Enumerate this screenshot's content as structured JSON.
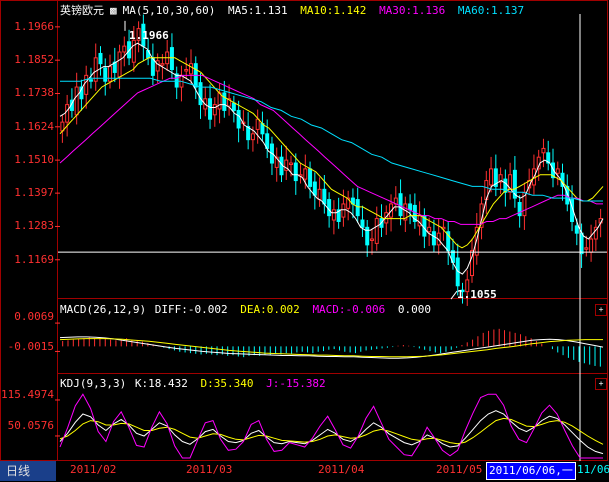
{
  "colors": {
    "up": "#ff3030",
    "down": "#00ffff",
    "ma5": "#ffffff",
    "ma10": "#ffff00",
    "ma30": "#ff00ff",
    "ma60": "#00e0ff",
    "axis": "#ff3030",
    "grid": "#a00000"
  },
  "price_panel": {
    "instrument": "英镑欧元",
    "ma_label": "MA(5,10,30,60)",
    "ma5": "MA5:1.131",
    "ma10": "MA10:1.142",
    "ma30": "MA30:1.136",
    "ma60": "MA60:1.137",
    "high_label": "1.1966",
    "low_label": "1.1055",
    "ticks": [
      "1.1966",
      "1.1852",
      "1.1738",
      "1.1624",
      "1.1510",
      "1.1397",
      "1.1283",
      "1.1169"
    ]
  },
  "macd_panel": {
    "label": "MACD(26,12,9)",
    "diff": "DIFF:-0.002",
    "dea": "DEA:0.002",
    "macd": "MACD:-0.006",
    "extra": "0.000",
    "ticks": [
      "0.0069",
      "-0.0015"
    ]
  },
  "kdj_panel": {
    "label": "KDJ(9,3,3)",
    "k": "K:18.432",
    "d": "D:35.340",
    "j": "J:-15.382",
    "ticks": [
      "115.4974",
      "50.0576"
    ]
  },
  "footer": {
    "period_tab": "日线",
    "dates": [
      "2011/02",
      "2011/03",
      "2011/04",
      "2011/05"
    ],
    "cursor_date": "2011/06/06,一",
    "tail_date": "11/06"
  },
  "chart_data": [
    {
      "type": "candlestick",
      "title": "英镑欧元",
      "y_axis_ticks": [
        1.1966,
        1.1852,
        1.1738,
        1.1624,
        1.151,
        1.1397,
        1.1283,
        1.1169
      ],
      "ylim": [
        1.1045,
        1.201
      ],
      "x_ticks": [
        "2011/02",
        "2011/03",
        "2011/04",
        "2011/05"
      ],
      "annotations": [
        {
          "label": "1.1966",
          "kind": "high"
        },
        {
          "label": "1.1055",
          "kind": "low"
        }
      ],
      "series": [
        {
          "name": "MA5",
          "last": 1.131
        },
        {
          "name": "MA10",
          "last": 1.142
        },
        {
          "name": "MA30",
          "last": 1.136
        },
        {
          "name": "MA60",
          "last": 1.137
        }
      ],
      "closes": [
        1.164,
        1.17,
        1.168,
        1.176,
        1.172,
        1.18,
        1.178,
        1.186,
        1.184,
        1.178,
        1.183,
        1.181,
        1.188,
        1.19,
        1.186,
        1.192,
        1.196,
        1.19,
        1.186,
        1.18,
        1.185,
        1.184,
        1.188,
        1.182,
        1.176,
        1.18,
        1.182,
        1.184,
        1.176,
        1.17,
        1.172,
        1.165,
        1.17,
        1.174,
        1.168,
        1.172,
        1.168,
        1.162,
        1.164,
        1.158,
        1.16,
        1.165,
        1.16,
        1.155,
        1.15,
        1.152,
        1.146,
        1.151,
        1.15,
        1.144,
        1.146,
        1.148,
        1.142,
        1.139,
        1.141,
        1.136,
        1.132,
        1.134,
        1.13,
        1.136,
        1.138,
        1.136,
        1.132,
        1.128,
        1.122,
        1.124,
        1.131,
        1.128,
        1.133,
        1.136,
        1.138,
        1.132,
        1.136,
        1.134,
        1.13,
        1.132,
        1.125,
        1.128,
        1.122,
        1.126,
        1.128,
        1.12,
        1.116,
        1.108,
        1.106,
        1.11,
        1.12,
        1.128,
        1.136,
        1.144,
        1.148,
        1.142,
        1.146,
        1.14,
        1.146,
        1.138,
        1.132,
        1.14,
        1.144,
        1.148,
        1.152,
        1.155,
        1.15,
        1.145,
        1.148,
        1.142,
        1.136,
        1.13,
        1.126,
        1.119,
        1.121,
        1.124,
        1.128,
        1.131
      ],
      "ma_lines": {
        "MA5": [
          1.166,
          1.167,
          1.169,
          1.172,
          1.174,
          1.177,
          1.179,
          1.181,
          1.182,
          1.183,
          1.183,
          1.184,
          1.185,
          1.186,
          1.188,
          1.19,
          1.191,
          1.19,
          1.189,
          1.186,
          1.184,
          1.183,
          1.182,
          1.181,
          1.18,
          1.18,
          1.179,
          1.178,
          1.175,
          1.172,
          1.17,
          1.169,
          1.169,
          1.17,
          1.17,
          1.169,
          1.167,
          1.166,
          1.163,
          1.162,
          1.161,
          1.159,
          1.157,
          1.154,
          1.153,
          1.151,
          1.149,
          1.148,
          1.146,
          1.146,
          1.145,
          1.142,
          1.14,
          1.138,
          1.137,
          1.135,
          1.133,
          1.133,
          1.134,
          1.134,
          1.133,
          1.131,
          1.128,
          1.127,
          1.127,
          1.128,
          1.129,
          1.131,
          1.133,
          1.135,
          1.135,
          1.134,
          1.133,
          1.131,
          1.13,
          1.128,
          1.126,
          1.125,
          1.124,
          1.122,
          1.12,
          1.116,
          1.113,
          1.112,
          1.114,
          1.118,
          1.124,
          1.131,
          1.138,
          1.142,
          1.143,
          1.144,
          1.143,
          1.141,
          1.139,
          1.138,
          1.139,
          1.143,
          1.146,
          1.15,
          1.151,
          1.15,
          1.147,
          1.145,
          1.142,
          1.138,
          1.133,
          1.128,
          1.125,
          1.124,
          1.126,
          1.128,
          1.131
        ],
        "MA10": [
          1.16,
          1.162,
          1.164,
          1.166,
          1.168,
          1.17,
          1.172,
          1.174,
          1.176,
          1.177,
          1.178,
          1.179,
          1.18,
          1.181,
          1.182,
          1.184,
          1.185,
          1.186,
          1.186,
          1.186,
          1.186,
          1.186,
          1.186,
          1.185,
          1.184,
          1.183,
          1.182,
          1.181,
          1.179,
          1.177,
          1.175,
          1.173,
          1.172,
          1.171,
          1.17,
          1.169,
          1.168,
          1.167,
          1.165,
          1.163,
          1.162,
          1.16,
          1.158,
          1.156,
          1.154,
          1.152,
          1.15,
          1.149,
          1.148,
          1.147,
          1.145,
          1.143,
          1.141,
          1.14,
          1.139,
          1.138,
          1.136,
          1.135,
          1.135,
          1.134,
          1.133,
          1.132,
          1.131,
          1.131,
          1.131,
          1.131,
          1.131,
          1.132,
          1.132,
          1.132,
          1.131,
          1.13,
          1.129,
          1.128,
          1.126,
          1.124,
          1.122,
          1.121,
          1.122,
          1.124,
          1.127,
          1.13,
          1.133,
          1.136,
          1.138,
          1.14,
          1.141,
          1.141,
          1.142,
          1.143,
          1.144,
          1.145,
          1.146,
          1.146,
          1.146,
          1.145,
          1.144,
          1.142,
          1.14,
          1.138,
          1.137,
          1.137,
          1.138,
          1.14,
          1.142
        ],
        "MA30": [
          1.15,
          1.152,
          1.154,
          1.156,
          1.158,
          1.16,
          1.162,
          1.164,
          1.166,
          1.168,
          1.17,
          1.172,
          1.174,
          1.175,
          1.176,
          1.177,
          1.178,
          1.179,
          1.179,
          1.18,
          1.18,
          1.18,
          1.18,
          1.179,
          1.178,
          1.177,
          1.176,
          1.175,
          1.174,
          1.173,
          1.172,
          1.17,
          1.169,
          1.168,
          1.166,
          1.164,
          1.162,
          1.16,
          1.158,
          1.156,
          1.154,
          1.152,
          1.15,
          1.148,
          1.146,
          1.144,
          1.142,
          1.141,
          1.14,
          1.139,
          1.138,
          1.137,
          1.136,
          1.135,
          1.134,
          1.133,
          1.132,
          1.132,
          1.131,
          1.131,
          1.13,
          1.13,
          1.129,
          1.129,
          1.129,
          1.129,
          1.13,
          1.13,
          1.131,
          1.131,
          1.132,
          1.133,
          1.134,
          1.135,
          1.136,
          1.137,
          1.138,
          1.139,
          1.139,
          1.138,
          1.138,
          1.137,
          1.137,
          1.136,
          1.136
        ],
        "MA60": [
          1.178,
          1.178,
          1.178,
          1.179,
          1.179,
          1.179,
          1.179,
          1.179,
          1.179,
          1.179,
          1.178,
          1.178,
          1.178,
          1.177,
          1.176,
          1.176,
          1.175,
          1.174,
          1.173,
          1.172,
          1.171,
          1.169,
          1.168,
          1.166,
          1.165,
          1.163,
          1.162,
          1.16,
          1.158,
          1.157,
          1.155,
          1.153,
          1.152,
          1.15,
          1.149,
          1.148,
          1.147,
          1.146,
          1.145,
          1.144,
          1.143,
          1.142,
          1.142,
          1.141,
          1.141,
          1.14,
          1.14,
          1.139,
          1.139,
          1.138,
          1.138,
          1.138,
          1.137,
          1.137,
          1.137
        ]
      }
    },
    {
      "type": "bar",
      "title": "MACD(26,12,9)",
      "y_axis_ticks": [
        0.0069,
        -0.0015
      ],
      "ylim": [
        -0.007,
        0.009
      ],
      "series": [
        {
          "name": "DIFF",
          "last": -0.002
        },
        {
          "name": "DEA",
          "last": 0.002
        },
        {
          "name": "MACD",
          "last": -0.006
        }
      ],
      "macd_bars": [
        0.0016,
        0.0018,
        0.002,
        0.0022,
        0.0024,
        0.0026,
        0.0024,
        0.0026,
        0.0022,
        0.002,
        0.0018,
        0.0022,
        0.0024,
        0.002,
        0.0018,
        0.0014,
        0.001,
        0.0006,
        0.0002,
        -0.0004,
        -0.0008,
        -0.0012,
        -0.0016,
        -0.0018,
        -0.002,
        -0.0022,
        -0.0024,
        -0.0022,
        -0.0024,
        -0.0026,
        -0.0024,
        -0.0028,
        -0.0026,
        -0.003,
        -0.0032,
        -0.0028,
        -0.0026,
        -0.0028,
        -0.0024,
        -0.0026,
        -0.0022,
        -0.0024,
        -0.002,
        -0.0022,
        -0.0018,
        -0.0016,
        -0.0018,
        -0.002,
        -0.0016,
        -0.0014,
        -0.001,
        -0.0008,
        -0.0012,
        -0.0016,
        -0.0018,
        -0.002,
        -0.0016,
        -0.0012,
        -0.001,
        -0.0008,
        -0.0006,
        -0.0004,
        -0.0002,
        0.0002,
        0.0004,
        0.0002,
        -0.0002,
        -0.0006,
        -0.001,
        -0.0014,
        -0.0018,
        -0.002,
        -0.0016,
        -0.001,
        -0.0004,
        0.0004,
        0.0012,
        0.002,
        0.003,
        0.004,
        0.0046,
        0.005,
        0.0052,
        0.0048,
        0.0044,
        0.004,
        0.0036,
        0.003,
        0.0024,
        0.0016,
        0.0008,
        0.0,
        -0.0008,
        -0.0018,
        -0.0026,
        -0.0034,
        -0.004,
        -0.0046,
        -0.005,
        -0.0054,
        -0.0058,
        -0.006
      ],
      "diff": [
        0.0026,
        0.0027,
        0.0028,
        0.0028,
        0.0027,
        0.0025,
        0.0022,
        0.0018,
        0.0014,
        0.001,
        0.0006,
        0.0002,
        -0.0002,
        -0.0006,
        -0.0009,
        -0.0012,
        -0.0015,
        -0.0017,
        -0.0019,
        -0.0021,
        -0.0022,
        -0.0023,
        -0.0024,
        -0.0025,
        -0.0026,
        -0.0027,
        -0.0027,
        -0.0028,
        -0.0028,
        -0.0029,
        -0.003,
        -0.003,
        -0.0031,
        -0.0031,
        -0.0032,
        -0.0033,
        -0.0034,
        -0.0035,
        -0.0035,
        -0.0034,
        -0.0032,
        -0.0029,
        -0.0026,
        -0.0022,
        -0.0018,
        -0.0014,
        -0.001,
        -0.0006,
        -0.0002,
        0.0002,
        0.0006,
        0.001,
        0.0014,
        0.0018,
        0.002,
        0.0021,
        0.002,
        0.0017,
        0.0013,
        0.0008,
        0.0003,
        -0.0002
      ],
      "dea": [
        0.002,
        0.0021,
        0.0022,
        0.0023,
        0.0023,
        0.0023,
        0.0022,
        0.0021,
        0.0019,
        0.0017,
        0.0015,
        0.0012,
        0.0009,
        0.0006,
        0.0003,
        0.0,
        -0.0003,
        -0.0006,
        -0.0009,
        -0.0012,
        -0.0014,
        -0.0016,
        -0.0018,
        -0.002,
        -0.0021,
        -0.0022,
        -0.0023,
        -0.0024,
        -0.0025,
        -0.0026,
        -0.0026,
        -0.0027,
        -0.0028,
        -0.0028,
        -0.0029,
        -0.003,
        -0.003,
        -0.0031,
        -0.0031,
        -0.0031,
        -0.003,
        -0.0029,
        -0.0027,
        -0.0025,
        -0.0022,
        -0.0019,
        -0.0016,
        -0.0013,
        -0.001,
        -0.0006,
        -0.0003,
        0.0,
        0.0004,
        0.0008,
        0.0011,
        0.0014,
        0.0016,
        0.0018,
        0.0019,
        0.002,
        0.002,
        0.002
      ]
    },
    {
      "type": "line",
      "title": "KDJ(9,3,3)",
      "y_axis_ticks": [
        115.4974,
        50.0576
      ],
      "ylim": [
        10,
        130
      ],
      "series": [
        {
          "name": "K",
          "last": 18.432,
          "values": [
            40,
            55,
            75,
            90,
            85,
            70,
            60,
            72,
            80,
            70,
            55,
            50,
            62,
            74,
            68,
            52,
            40,
            35,
            45,
            58,
            62,
            50,
            40,
            38,
            42,
            55,
            60,
            48,
            38,
            36,
            40,
            38,
            36,
            42,
            52,
            62,
            55,
            44,
            40,
            48,
            62,
            74,
            66,
            54,
            46,
            38,
            34,
            40,
            52,
            46,
            36,
            30,
            32,
            46,
            62,
            78,
            90,
            96,
            90,
            76,
            64,
            58,
            66,
            78,
            86,
            82,
            70,
            56,
            42,
            30,
            22,
            18
          ]
        },
        {
          "name": "D",
          "last": 35.34,
          "values": [
            45,
            50,
            60,
            72,
            78,
            76,
            70,
            70,
            73,
            72,
            66,
            60,
            60,
            64,
            66,
            62,
            55,
            48,
            46,
            50,
            54,
            53,
            48,
            44,
            43,
            47,
            51,
            50,
            46,
            42,
            41,
            40,
            39,
            40,
            44,
            50,
            52,
            49,
            46,
            47,
            52,
            59,
            62,
            59,
            54,
            49,
            44,
            42,
            45,
            46,
            42,
            38,
            36,
            39,
            47,
            57,
            68,
            78,
            82,
            80,
            74,
            68,
            67,
            71,
            76,
            78,
            75,
            68,
            59,
            50,
            42,
            35
          ]
        },
        {
          "name": "J",
          "last": -15.382,
          "values": [
            30,
            65,
            105,
            126,
            100,
            58,
            40,
            76,
            94,
            66,
            33,
            30,
            66,
            94,
            72,
            32,
            10,
            10,
            43,
            74,
            78,
            44,
            24,
            26,
            40,
            71,
            78,
            44,
            22,
            24,
            38,
            34,
            30,
            46,
            68,
            86,
            61,
            34,
            28,
            50,
            82,
            104,
            74,
            44,
            30,
            16,
            14,
            36,
            66,
            46,
            24,
            14,
            24,
            60,
            92,
            120,
            126,
            126,
            106,
            68,
            44,
            38,
            64,
            92,
            106,
            90,
            60,
            32,
            10,
            10,
            10,
            10
          ]
        }
      ]
    }
  ]
}
